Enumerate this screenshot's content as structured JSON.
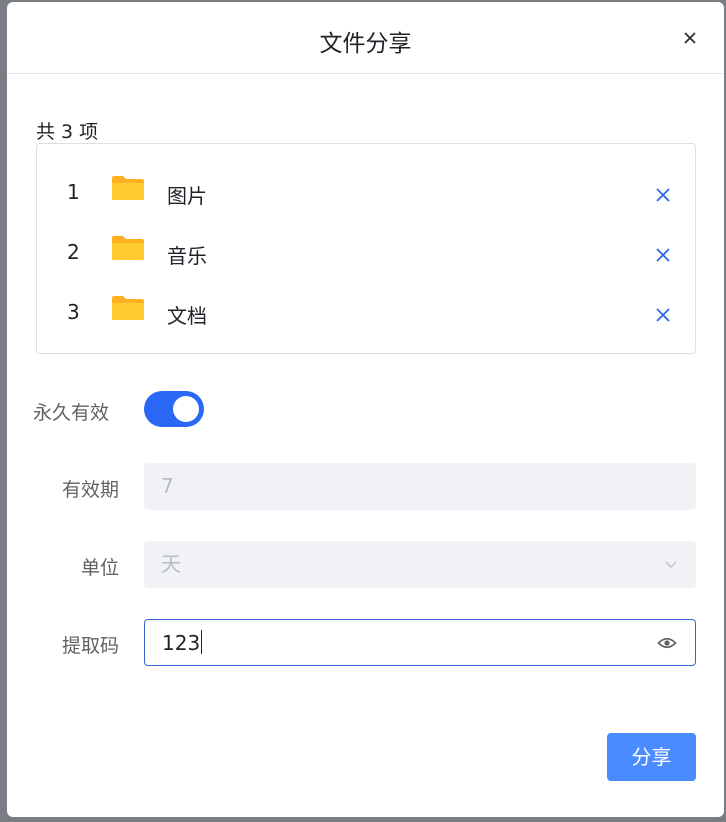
{
  "dialog": {
    "title": "文件分享",
    "close_icon": "close-icon"
  },
  "files": {
    "count_label": "共 3 项",
    "items": [
      {
        "index": "1",
        "name": "图片",
        "icon": "folder-icon"
      },
      {
        "index": "2",
        "name": "音乐",
        "icon": "folder-icon"
      },
      {
        "index": "3",
        "name": "文档",
        "icon": "folder-icon"
      }
    ]
  },
  "form": {
    "permanent_label": "永久有效",
    "permanent_enabled": true,
    "validity_label": "有效期",
    "validity_value": "7",
    "unit_label": "单位",
    "unit_value": "天",
    "code_label": "提取码",
    "code_value": "123"
  },
  "footer": {
    "share_button": "分享"
  },
  "colors": {
    "primary": "#4a8bff",
    "toggle_on": "#2a67f5",
    "remove_icon": "#2a67f5",
    "folder": "#ffc629"
  }
}
